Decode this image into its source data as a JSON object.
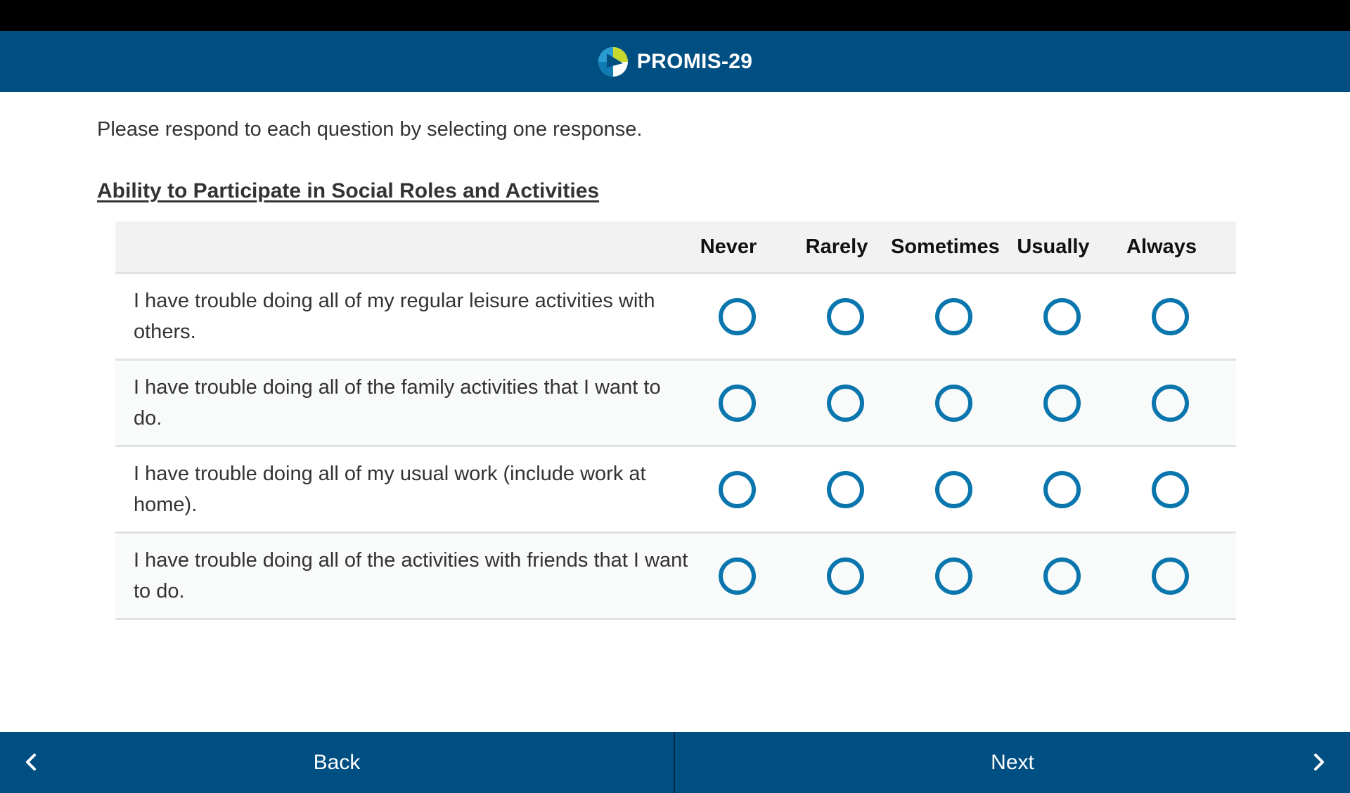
{
  "header": {
    "title": "PROMIS-29",
    "logo_icon": "promis-logo-icon",
    "background_color": "#004f83"
  },
  "instructions": "Please respond to each question by selecting one response.",
  "section_title": "Ability to Participate in Social Roles and Activities",
  "response_options": [
    "Never",
    "Rarely",
    "Sometimes",
    "Usually",
    "Always"
  ],
  "questions": [
    {
      "text": "I have trouble doing all of my regular leisure activities with others.",
      "selected": null
    },
    {
      "text": "I have trouble doing all of the family activities that I want to do.",
      "selected": null
    },
    {
      "text": "I have trouble doing all of my usual work (include work at home).",
      "selected": null
    },
    {
      "text": "I have trouble doing all of the activities with friends that I want to do.",
      "selected": null
    }
  ],
  "radio_color": "#0a76ad",
  "footer": {
    "back_label": "Back",
    "back_icon": "chevron-left-icon",
    "next_label": "Next",
    "next_icon": "chevron-right-icon"
  }
}
